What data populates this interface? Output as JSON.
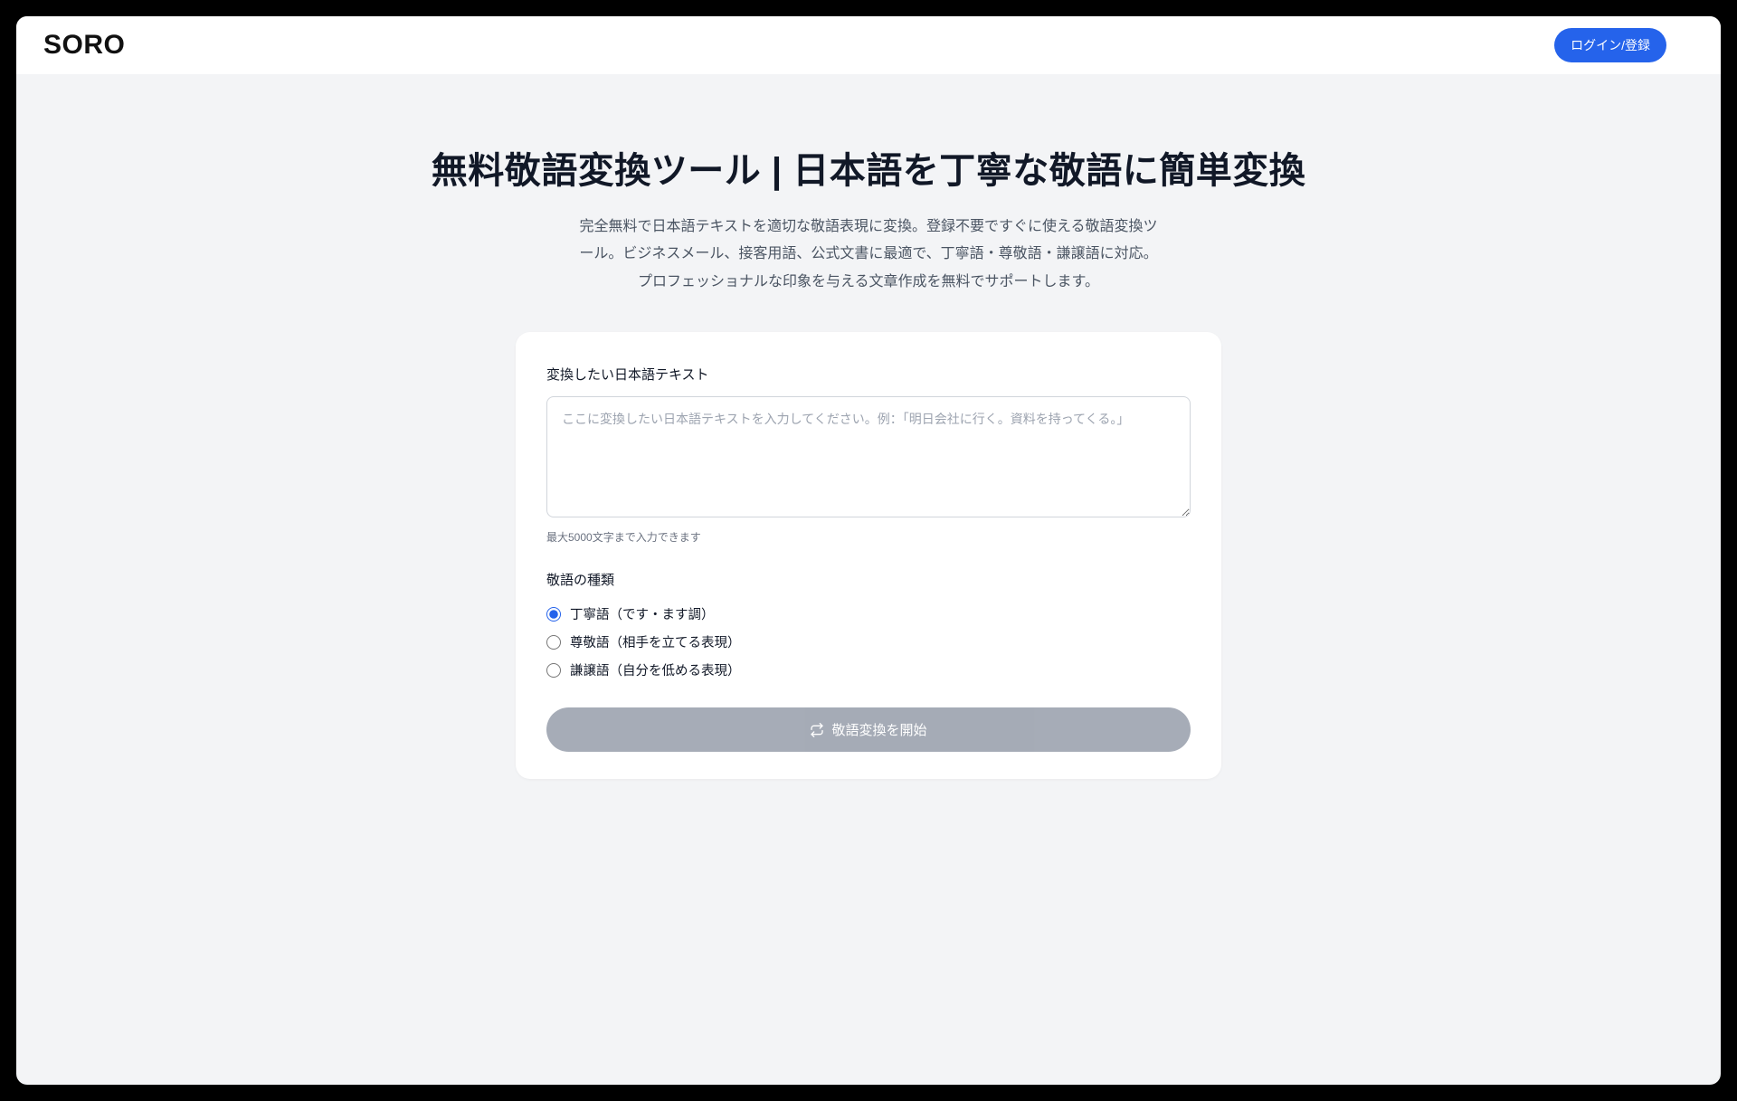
{
  "header": {
    "logo": "SORO",
    "login_label": "ログイン/登録"
  },
  "hero": {
    "title": "無料敬語変換ツール | 日本語を丁寧な敬語に簡単変換",
    "description": "完全無料で日本語テキストを適切な敬語表現に変換。登録不要ですぐに使える敬語変換ツール。ビジネスメール、接客用語、公式文書に最適で、丁寧語・尊敬語・謙譲語に対応。プロフェッショナルな印象を与える文章作成を無料でサポートします。"
  },
  "form": {
    "input_label": "変換したい日本語テキスト",
    "input_placeholder": "ここに変換したい日本語テキストを入力してください。例：「明日会社に行く。資料を持ってくる。」",
    "input_value": "",
    "input_hint": "最大5000文字まで入力できます",
    "type_label": "敬語の種類",
    "options": [
      {
        "label": "丁寧語（です・ます調）",
        "checked": true
      },
      {
        "label": "尊敬語（相手を立てる表現）",
        "checked": false
      },
      {
        "label": "謙譲語（自分を低める表現）",
        "checked": false
      }
    ],
    "submit_label": "敬語変換を開始"
  }
}
